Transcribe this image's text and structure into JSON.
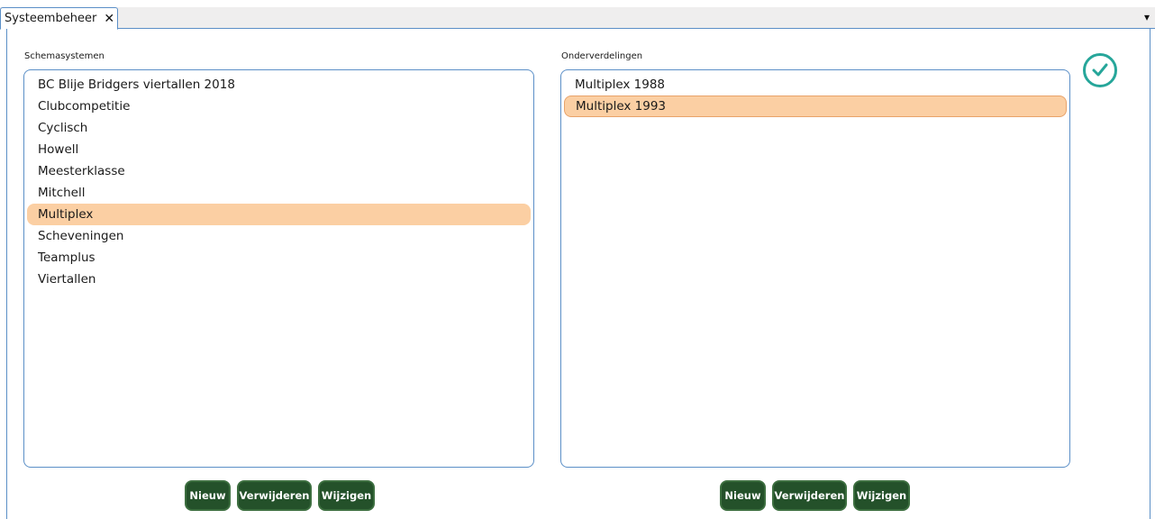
{
  "tab": {
    "title": "Systeembeheer",
    "close_glyph": "✕"
  },
  "menu_glyph": "▾",
  "left": {
    "label": "Schemasystemen",
    "items": [
      {
        "label": "BC Blije Bridgers viertallen 2018",
        "selected": false
      },
      {
        "label": "Clubcompetitie",
        "selected": false
      },
      {
        "label": "Cyclisch",
        "selected": false
      },
      {
        "label": "Howell",
        "selected": false
      },
      {
        "label": "Meesterklasse",
        "selected": false
      },
      {
        "label": "Mitchell",
        "selected": false
      },
      {
        "label": "Multiplex",
        "selected": true
      },
      {
        "label": "Scheveningen",
        "selected": false
      },
      {
        "label": "Teamplus",
        "selected": false
      },
      {
        "label": "Viertallen",
        "selected": false
      }
    ],
    "buttons": {
      "new": "Nieuw",
      "delete": "Verwijderen",
      "edit": "Wijzigen"
    }
  },
  "right": {
    "label": "Onderverdelingen",
    "items": [
      {
        "label": "Multiplex 1988",
        "selected": false
      },
      {
        "label": "Multiplex 1993",
        "selected": true
      }
    ],
    "buttons": {
      "new": "Nieuw",
      "delete": "Verwijderen",
      "edit": "Wijzigen"
    }
  },
  "confirm_icon": "checkmark-circle-icon",
  "colors": {
    "accent_border": "#5b8fc7",
    "selection": "#fbcfa3",
    "button_bg": "#24512a",
    "confirm": "#26a69a"
  }
}
